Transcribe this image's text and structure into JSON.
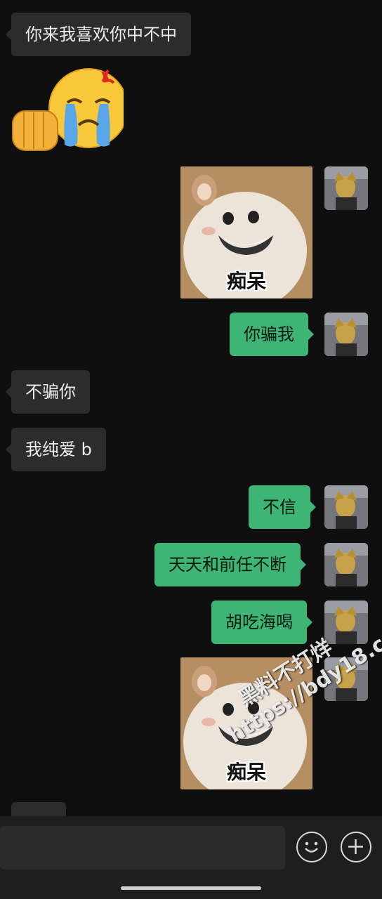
{
  "messages": [
    {
      "side": "in",
      "type": "text",
      "text": "你来我喜欢你中不中"
    },
    {
      "side": "in",
      "type": "sticker",
      "icon": "crying-angry-fist-emoji"
    },
    {
      "side": "out",
      "type": "sticker",
      "caption": "痴呆",
      "icon": "hamster-meme"
    },
    {
      "side": "out",
      "type": "text",
      "text": "你骗我"
    },
    {
      "side": "in",
      "type": "text",
      "text": "不骗你"
    },
    {
      "side": "in",
      "type": "text",
      "text": "我纯爱 b"
    },
    {
      "side": "out",
      "type": "text",
      "text": "不信"
    },
    {
      "side": "out",
      "type": "text",
      "text": "天天和前任不断"
    },
    {
      "side": "out",
      "type": "text",
      "text": "胡吃海喝"
    },
    {
      "side": "out",
      "type": "sticker",
      "caption": "痴呆",
      "icon": "hamster-meme"
    }
  ],
  "watermark": {
    "line1": "黑料不打烊",
    "line2": "https://bdy18.co"
  },
  "input_bar": {
    "placeholder": "",
    "emoji_icon": "smiley-icon",
    "plus_icon": "plus-icon"
  },
  "colors": {
    "background": "#0f0f0f",
    "incoming_bubble": "#2c2c2c",
    "outgoing_bubble": "#3eb575"
  }
}
